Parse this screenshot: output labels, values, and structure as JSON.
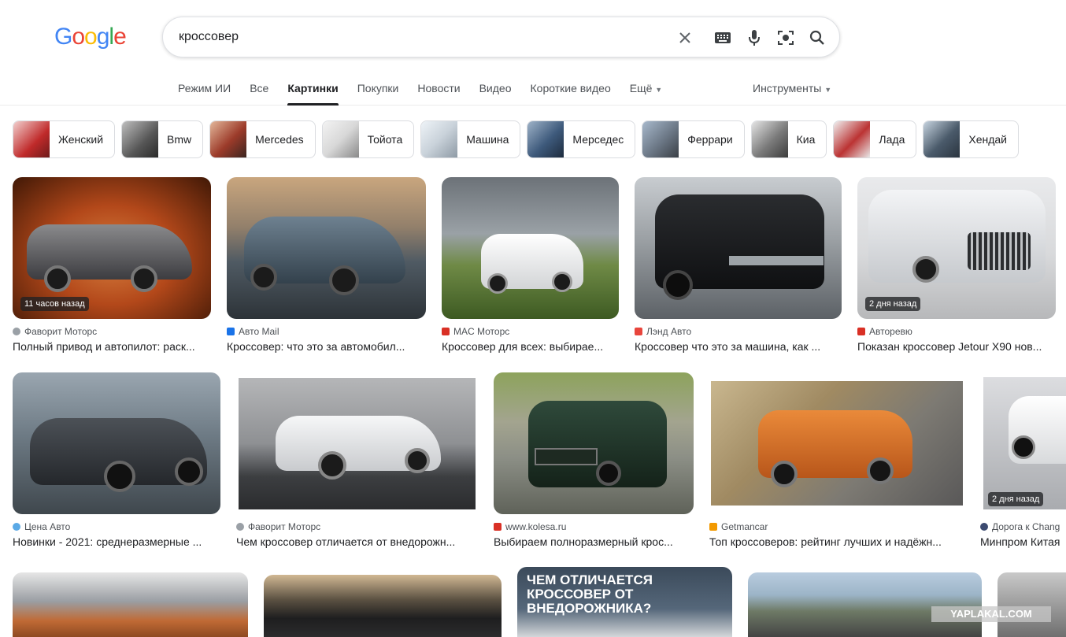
{
  "logo": {
    "text": "Google"
  },
  "search": {
    "query": "кроссовер"
  },
  "tabs": [
    {
      "label": "Режим ИИ"
    },
    {
      "label": "Все"
    },
    {
      "label": "Картинки"
    },
    {
      "label": "Покупки"
    },
    {
      "label": "Новости"
    },
    {
      "label": "Видео"
    },
    {
      "label": "Короткие видео"
    },
    {
      "label": "Ещё"
    }
  ],
  "tools": {
    "label": "Инструменты"
  },
  "chips": [
    {
      "label": "Женский"
    },
    {
      "label": "Bmw"
    },
    {
      "label": "Mercedes"
    },
    {
      "label": "Тойота"
    },
    {
      "label": "Машина"
    },
    {
      "label": "Мерседес"
    },
    {
      "label": "Феррари"
    },
    {
      "label": "Киа"
    },
    {
      "label": "Лада"
    },
    {
      "label": "Хендай"
    }
  ],
  "results": [
    {
      "source": "Фаворит Моторс",
      "title": "Полный привод и автопилот: раск...",
      "badge": "11 часов назад"
    },
    {
      "source": "Авто Mail",
      "title": "Кроссовер: что это за автомобил...",
      "badge": ""
    },
    {
      "source": "MAC Моторс",
      "title": "Кроссовер для всех: выбирае...",
      "badge": ""
    },
    {
      "source": "Лэнд Авто",
      "title": "Кроссовер что это за машина, как ...",
      "badge": ""
    },
    {
      "source": "Авторевю",
      "title": "Показан кроссовер Jetour X90 нов...",
      "badge": "2 дня назад"
    },
    {
      "source": "Цена Авто",
      "title": "Новинки - 2021: среднеразмерные ...",
      "badge": ""
    },
    {
      "source": "Фаворит Моторс",
      "title": "Чем кроссовер отличается от внедорожн...",
      "badge": ""
    },
    {
      "source": "www.kolesa.ru",
      "title": "Выбираем полноразмерный крос...",
      "badge": ""
    },
    {
      "source": "Getmancar",
      "title": "Топ кроссоверов: рейтинг лучших и надёжн...",
      "badge": ""
    },
    {
      "source": "Дорога к Chang",
      "title": "Минпром Китая",
      "badge": "2 дня назад"
    }
  ],
  "row3": {
    "banner_text": "ЧЕМ ОТЛИЧАЕТСЯ КРОССОВЕР ОТ ВНЕДОРОЖНИКА?"
  },
  "watermark": {
    "text": "YAPLAKAL.COM"
  }
}
